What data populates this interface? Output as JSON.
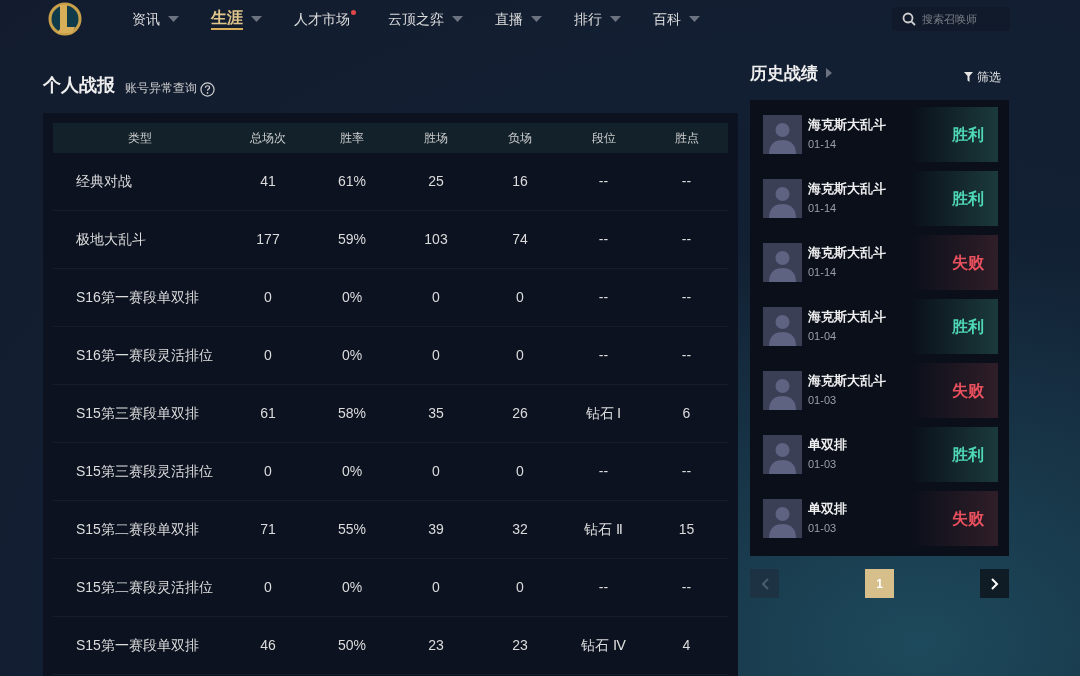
{
  "nav": {
    "items": [
      {
        "label": "资讯",
        "selected": false,
        "dropdown": true,
        "dot": false
      },
      {
        "label": "生涯",
        "selected": true,
        "dropdown": true,
        "dot": false
      },
      {
        "label": "人才市场",
        "selected": false,
        "dropdown": false,
        "dot": true
      },
      {
        "label": "云顶之弈",
        "selected": false,
        "dropdown": true,
        "dot": false
      },
      {
        "label": "直播",
        "selected": false,
        "dropdown": true,
        "dot": false
      },
      {
        "label": "排行",
        "selected": false,
        "dropdown": true,
        "dot": false
      },
      {
        "label": "百科",
        "selected": false,
        "dropdown": true,
        "dot": false
      }
    ],
    "search": {
      "placeholder": "搜索召唤师"
    }
  },
  "stats": {
    "title": "个人战报",
    "link": "账号异常查询",
    "columns": [
      "类型",
      "总场次",
      "胜率",
      "胜场",
      "负场",
      "段位",
      "胜点"
    ],
    "rows": [
      [
        "经典对战",
        "41",
        "61%",
        "25",
        "16",
        "--",
        "--"
      ],
      [
        "极地大乱斗",
        "177",
        "59%",
        "103",
        "74",
        "--",
        "--"
      ],
      [
        "S16第一赛段单双排",
        "0",
        "0%",
        "0",
        "0",
        "--",
        "--"
      ],
      [
        "S16第一赛段灵活排位",
        "0",
        "0%",
        "0",
        "0",
        "--",
        "--"
      ],
      [
        "S15第三赛段单双排",
        "61",
        "58%",
        "35",
        "26",
        "钻石 Ⅰ",
        "6"
      ],
      [
        "S15第三赛段灵活排位",
        "0",
        "0%",
        "0",
        "0",
        "--",
        "--"
      ],
      [
        "S15第二赛段单双排",
        "71",
        "55%",
        "39",
        "32",
        "钻石 Ⅱ",
        "15"
      ],
      [
        "S15第二赛段灵活排位",
        "0",
        "0%",
        "0",
        "0",
        "--",
        "--"
      ],
      [
        "S15第一赛段单双排",
        "46",
        "50%",
        "23",
        "23",
        "钻石 Ⅳ",
        "4"
      ]
    ]
  },
  "history": {
    "title": "历史战绩",
    "filter": "筛选",
    "matches": [
      {
        "mode": "海克斯大乱斗",
        "date": "01-14",
        "result": "胜利",
        "kind": "win"
      },
      {
        "mode": "海克斯大乱斗",
        "date": "01-14",
        "result": "胜利",
        "kind": "win"
      },
      {
        "mode": "海克斯大乱斗",
        "date": "01-14",
        "result": "失败",
        "kind": "loss"
      },
      {
        "mode": "海克斯大乱斗",
        "date": "01-04",
        "result": "胜利",
        "kind": "win"
      },
      {
        "mode": "海克斯大乱斗",
        "date": "01-03",
        "result": "失败",
        "kind": "loss"
      },
      {
        "mode": "单双排",
        "date": "01-03",
        "result": "胜利",
        "kind": "win"
      },
      {
        "mode": "单双排",
        "date": "01-03",
        "result": "失败",
        "kind": "loss"
      }
    ],
    "pagination": {
      "prev_disabled": true,
      "pages": [
        {
          "label": "1",
          "selected": true
        }
      ],
      "next_disabled": false
    }
  }
}
